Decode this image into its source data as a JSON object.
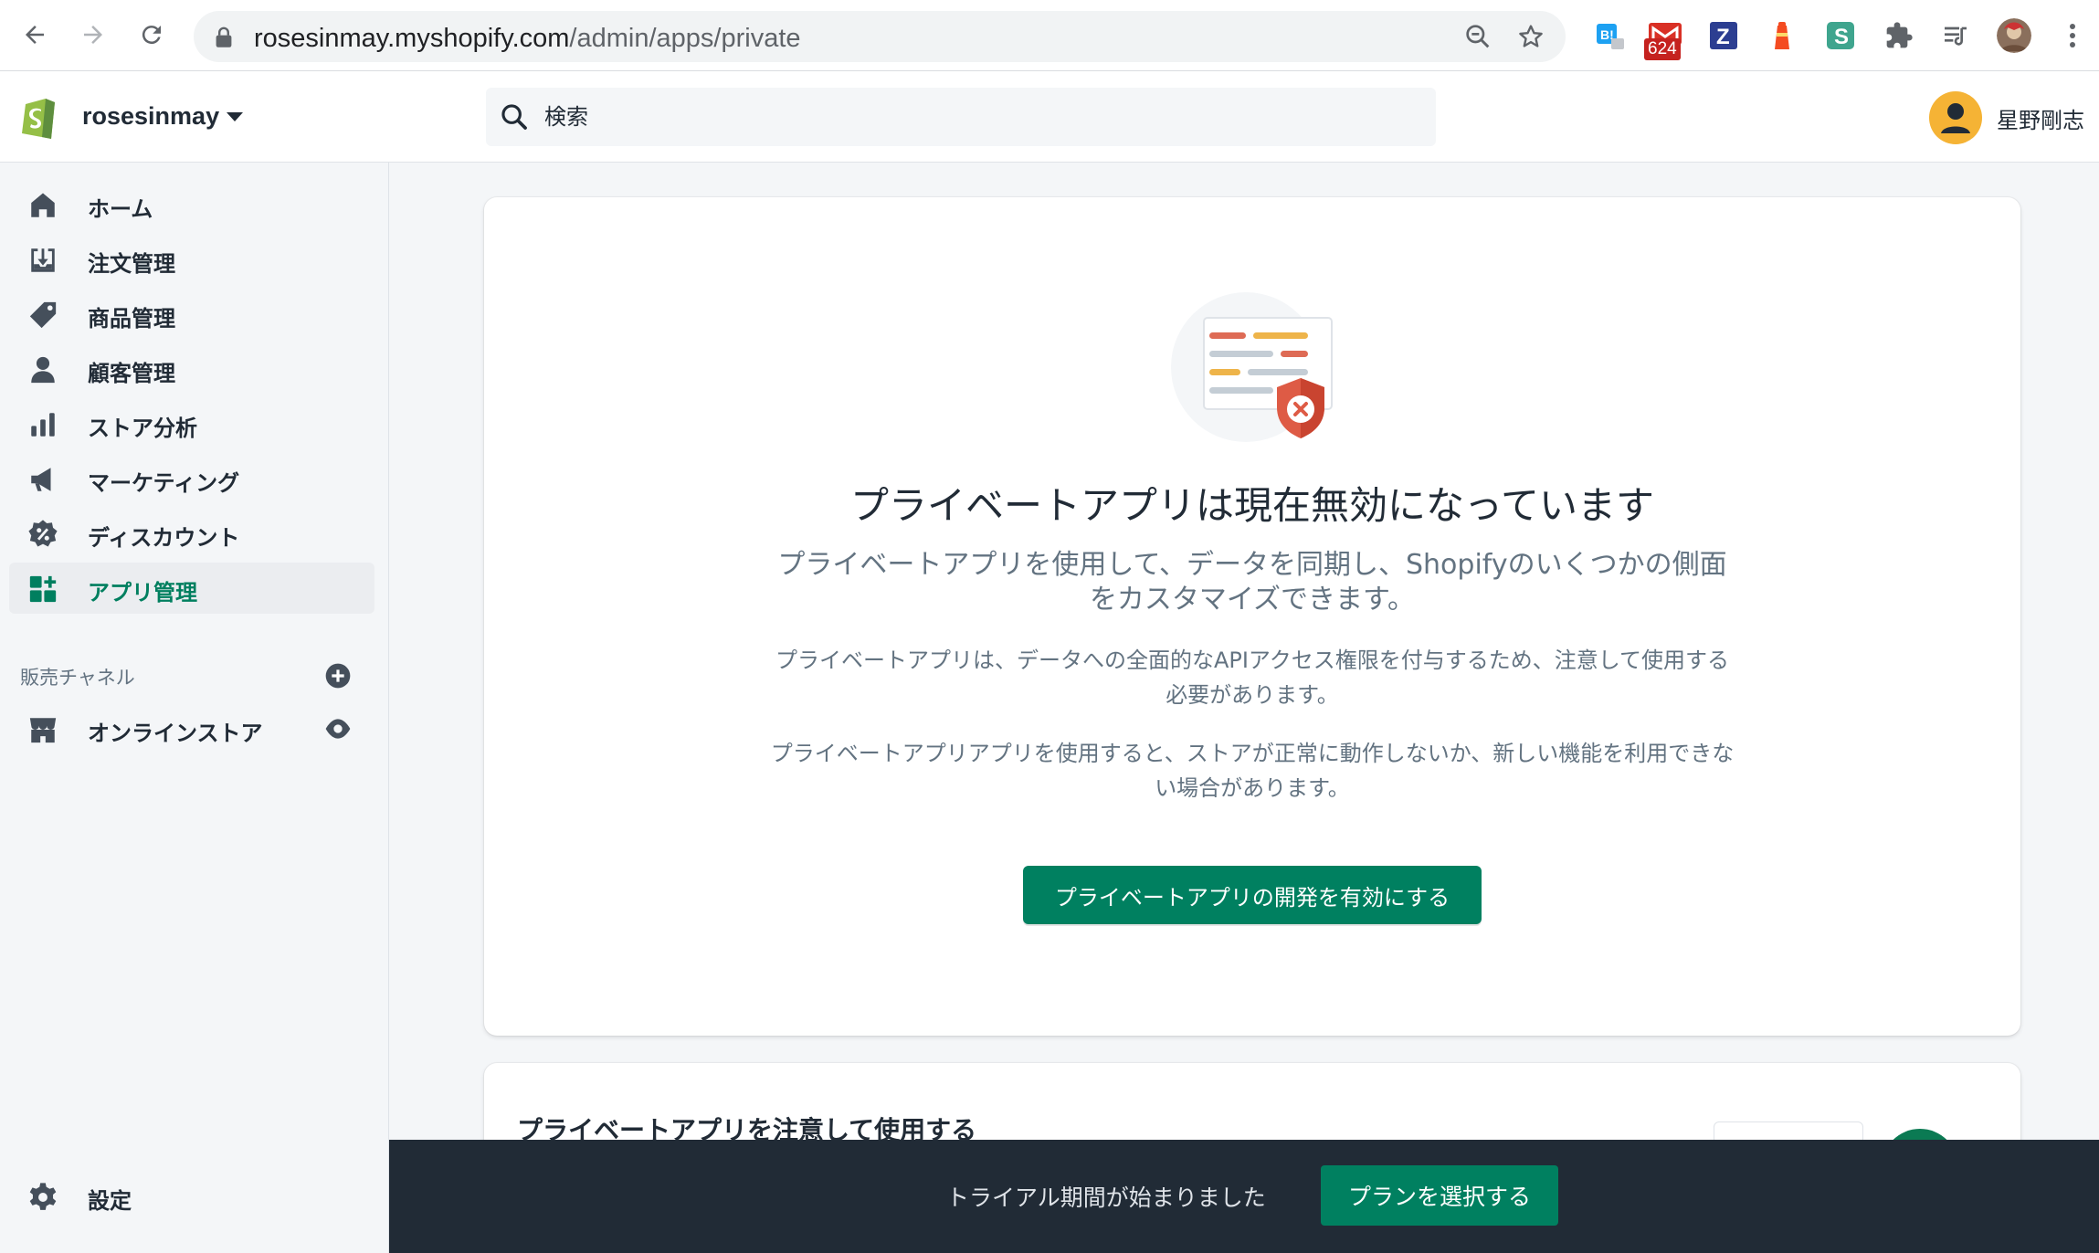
{
  "browser": {
    "url_host": "rosesinmay.myshopify.com",
    "url_path": "/admin/apps/private",
    "extension_badge": "624",
    "extensions": [
      "bookmark-extension-icon",
      "mail-extension-icon",
      "z-extension-icon",
      "lighthouse-extension-icon",
      "s-extension-icon",
      "puzzle-extensions-icon",
      "reading-list-icon",
      "profile-avatar-icon",
      "menu-dots-icon"
    ]
  },
  "topbar": {
    "store_name": "rosesinmay",
    "search_placeholder": "検索",
    "user_name": "星野剛志"
  },
  "sidebar": {
    "items": [
      {
        "label": "ホーム",
        "icon": "home-icon"
      },
      {
        "label": "注文管理",
        "icon": "orders-icon"
      },
      {
        "label": "商品管理",
        "icon": "tag-icon"
      },
      {
        "label": "顧客管理",
        "icon": "customer-icon"
      },
      {
        "label": "ストア分析",
        "icon": "analytics-icon"
      },
      {
        "label": "マーケティング",
        "icon": "megaphone-icon"
      },
      {
        "label": "ディスカウント",
        "icon": "discount-icon"
      },
      {
        "label": "アプリ管理",
        "icon": "apps-icon",
        "active": true
      }
    ],
    "channels_title": "販売チャネル",
    "online_store": "オンラインストア",
    "settings": "設定"
  },
  "main": {
    "title": "プライベートアプリは現在無効になっています",
    "subtitle": "プライベートアプリを使用して、データを同期し、Shopifyのいくつかの側面をカスタマイズできます。",
    "note1": "プライベートアプリは、データへの全面的なAPIアクセス権限を付与するため、注意して使用する必要があります。",
    "note2": "プライベートアプリアプリを使用すると、ストアが正常に動作しないか、新しい機能を利用できない場合があります。",
    "enable_button": "プライベートアプリの開発を有効にする",
    "card2_title": "プライベートアプリを注意して使用する"
  },
  "trial": {
    "text": "トライアル期間が始まりました",
    "button": "プランを選択する"
  },
  "colors": {
    "accent": "#008060",
    "active_text": "#007f5f",
    "trial_bar": "#212b36"
  }
}
